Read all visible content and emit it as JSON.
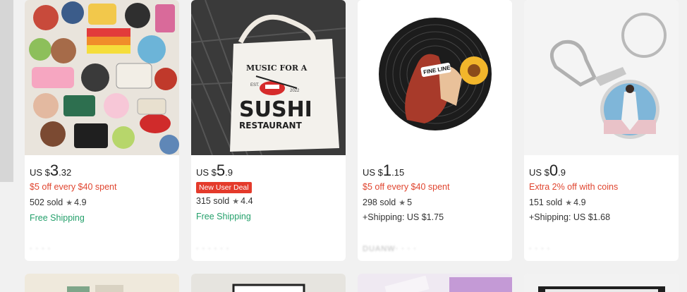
{
  "products": [
    {
      "price_currency": "US $",
      "price_int": "3",
      "price_dec": ".32",
      "promo": "$5 off every $40 spent",
      "sold": "502 sold",
      "rating": "4.9",
      "shipping": "Free Shipping",
      "store": "‧ ‧ ‧ ‧"
    },
    {
      "price_currency": "US $",
      "price_int": "5",
      "price_dec": ".9",
      "badge": "New User Deal",
      "sold": "315 sold",
      "rating": "4.4",
      "shipping": "Free Shipping",
      "store": "‧ ‧ ‧ ‧ ‧ ‧",
      "image_text": {
        "line1": "MUSIC FOR A",
        "line2": "SUSHI",
        "line3": "RESTAURANT",
        "est": "EST.",
        "year": "2022"
      }
    },
    {
      "price_currency": "US $",
      "price_int": "1",
      "price_dec": ".15",
      "promo": "$5 off every $40 spent",
      "sold": "298 sold",
      "rating": "5",
      "shipping": "+Shipping: US $1.75",
      "store": "DUANW‧ ‧ ‧ ‧",
      "image_text": {
        "label": "FINE LINE"
      }
    },
    {
      "price_currency": "US $",
      "price_int": "0",
      "price_dec": ".9",
      "promo": "Extra 2% off with coins",
      "sold": "151 sold",
      "rating": "4.9",
      "shipping": "+Shipping: US $1.68",
      "store": "‧ ‧ ‧ ‧"
    }
  ],
  "icons": {
    "rating": "star-icon"
  },
  "colors": {
    "promo": "#e0452f",
    "free_shipping": "#24a06b",
    "badge": "#e43a2b"
  }
}
